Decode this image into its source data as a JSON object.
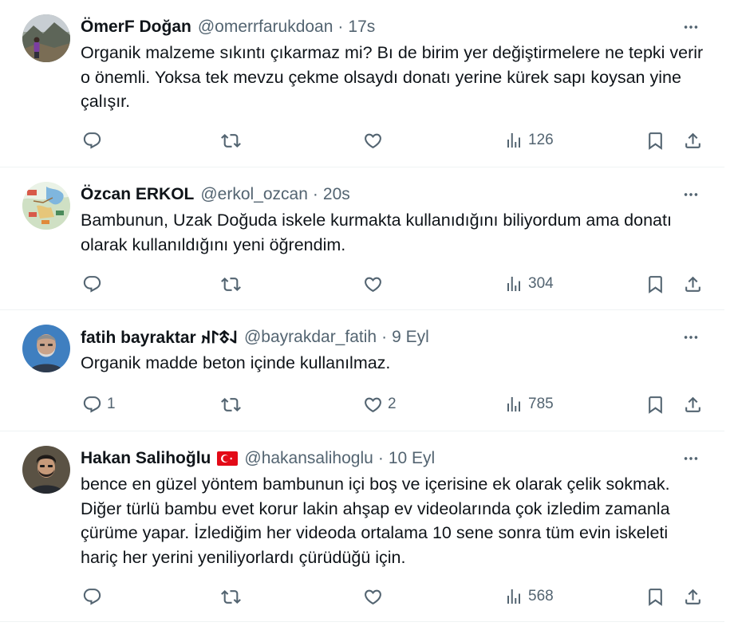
{
  "tweets": [
    {
      "name": "ÖmerF Doğan",
      "handle": "@omerrfarukdoan",
      "time": "17s",
      "text": "Organik malzeme sıkıntı çıkarmaz mi? Bı de birim yer değiştirmelere ne tepki verir o önemli. Yoksa tek mevzu çekme olsaydı donatı yerine kürek sapı koysan yine çalışır.",
      "replies": "",
      "retweets": "",
      "likes": "",
      "views": "126",
      "avatar_icon": "avatar-photo"
    },
    {
      "name": "Özcan ERKOL",
      "handle": "@erkol_ozcan",
      "time": "20s",
      "text": "Bambunun, Uzak Doğuda iskele kurmakta kullanıdığını biliyordum ama donatı olarak kullanıldığını yeni öğrendim.",
      "replies": "",
      "retweets": "",
      "likes": "",
      "views": "304",
      "avatar_icon": "avatar-map"
    },
    {
      "name": "fatih bayraktar 𐰞𐱃𐰃𐰴",
      "handle": "@bayrakdar_fatih",
      "time": "9 Eyl",
      "text": "Organik madde beton içinde kullanılmaz.",
      "replies": "1",
      "retweets": "",
      "likes": "2",
      "views": "785",
      "avatar_icon": "avatar-photo"
    },
    {
      "name": "Hakan Salihoğlu",
      "flag": "🇹🇷",
      "handle": "@hakansalihoglu",
      "time": "10 Eyl",
      "text": "bence en güzel yöntem bambunun içi boş ve içerisine ek olarak çelik sokmak. Diğer türlü bambu evet korur lakin ahşap ev videolarında çok izledim zamanla çürüme yapar. İzlediğim her videoda ortalama 10 sene sonra tüm evin iskeleti hariç her yerini yeniliyorlardı çürüdüğü için.",
      "replies": "",
      "retweets": "",
      "likes": "",
      "views": "568",
      "avatar_icon": "avatar-photo"
    }
  ],
  "separator": "·",
  "colors": {
    "text": "#0f1419",
    "secondary": "#536471",
    "border": "#eff3f4",
    "flag_red": "#e30a17"
  },
  "icons": [
    "reply-icon",
    "retweet-icon",
    "like-icon",
    "views-icon",
    "bookmark-icon",
    "share-icon",
    "more-icon"
  ]
}
